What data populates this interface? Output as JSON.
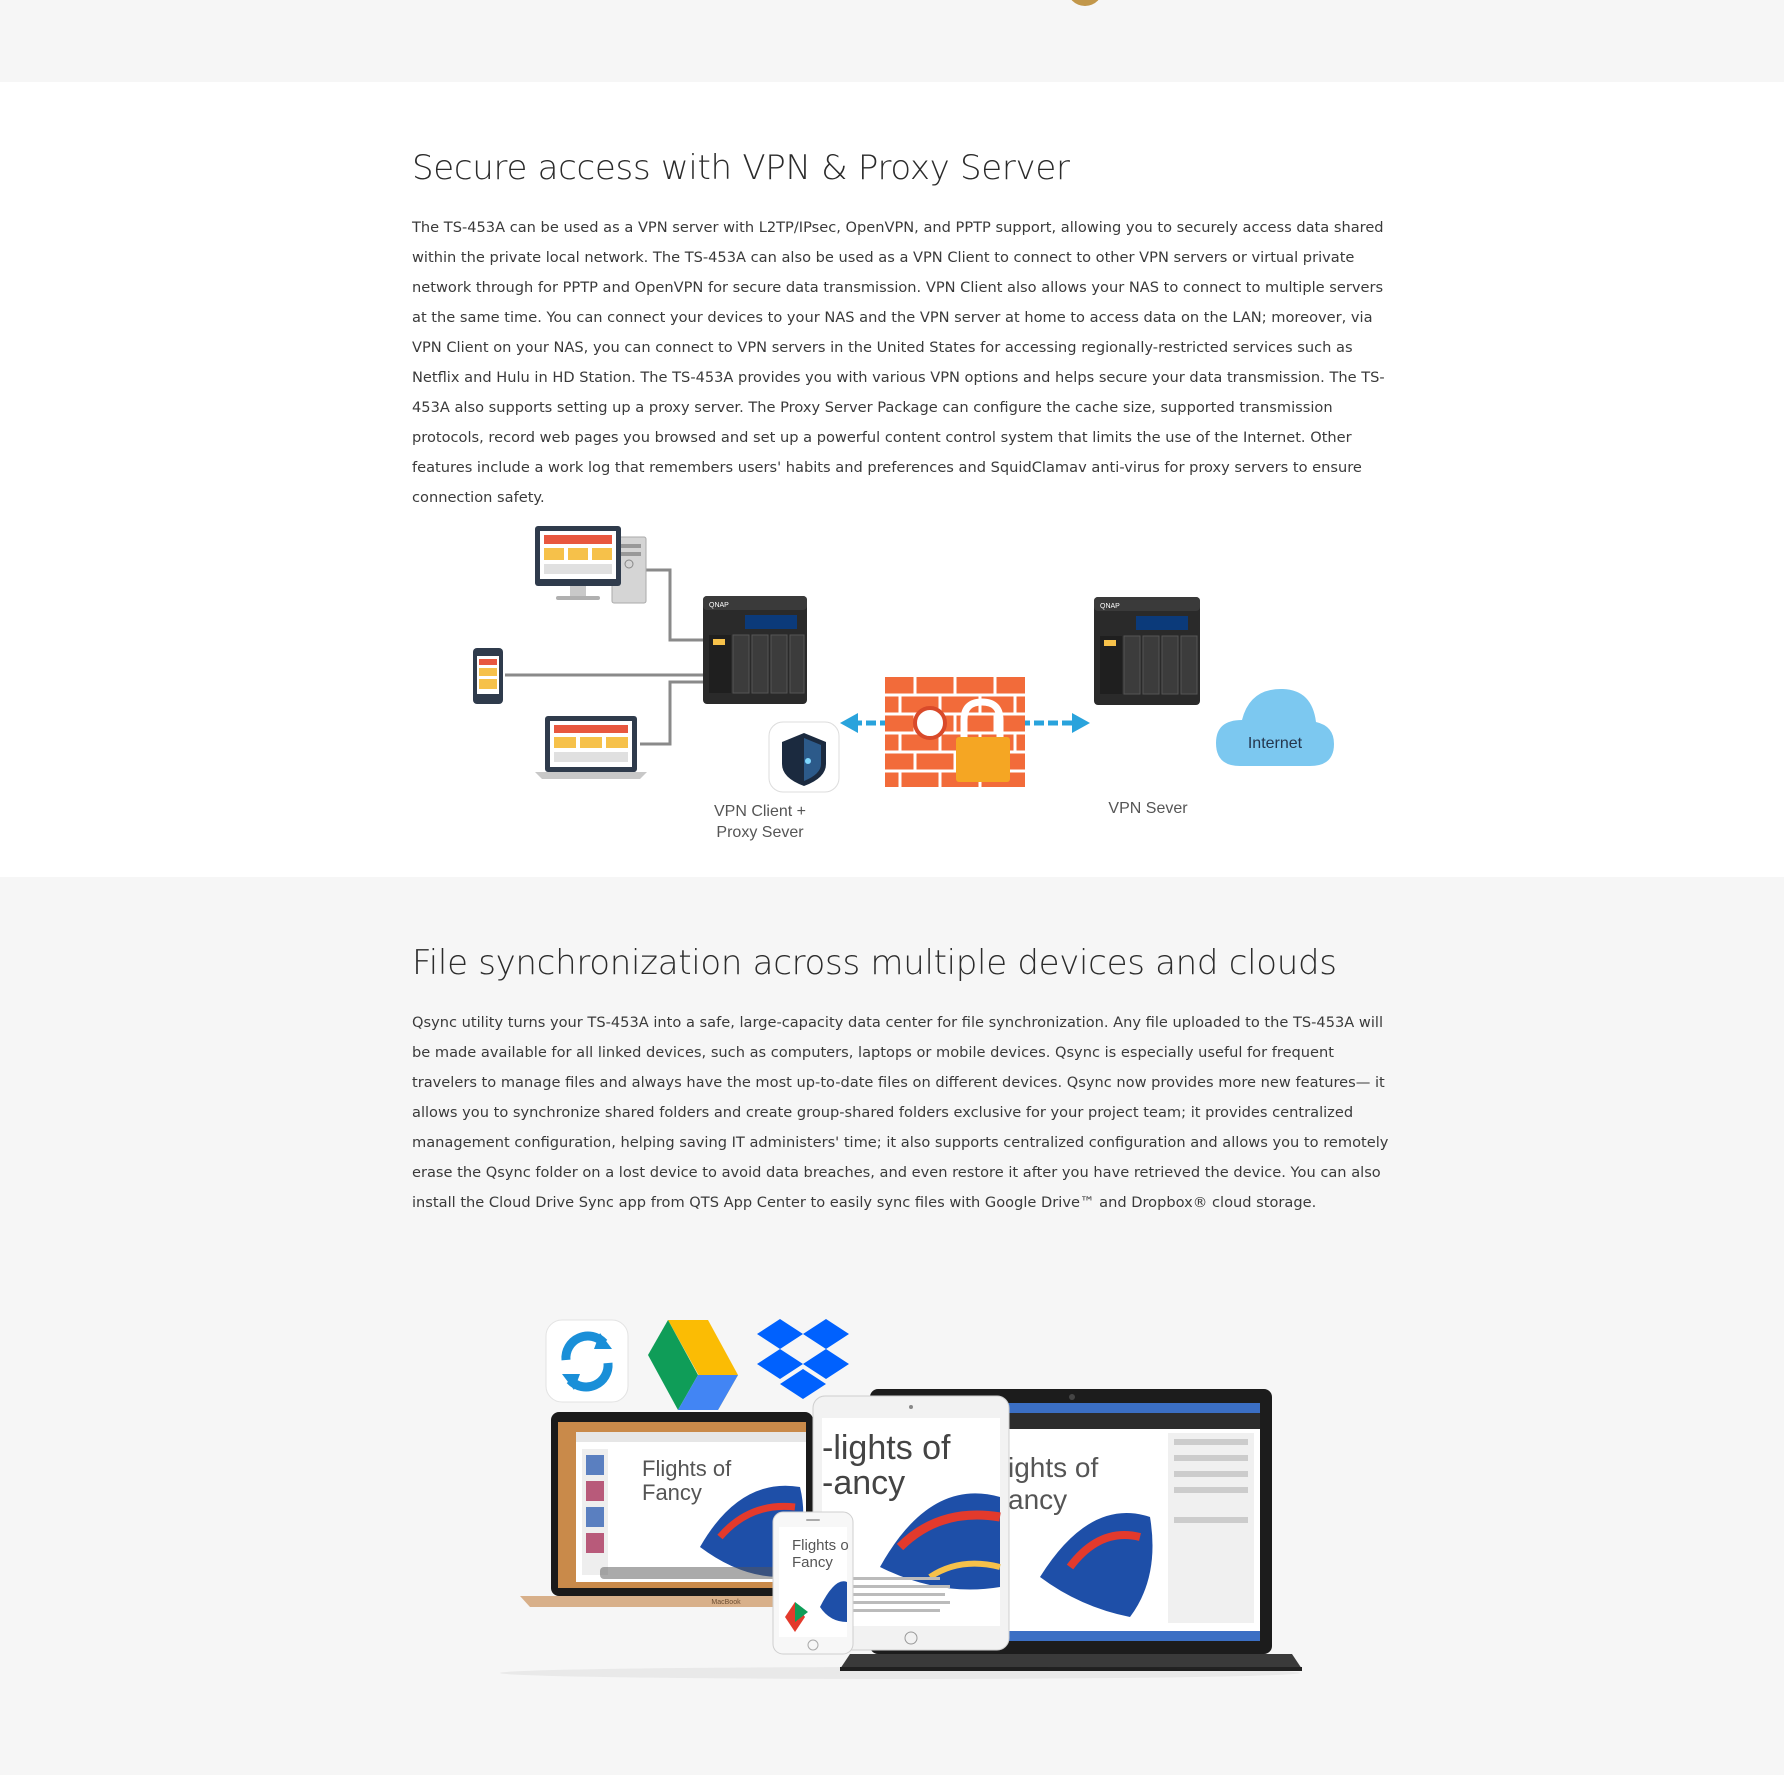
{
  "vpn": {
    "title": "Secure access with VPN & Proxy Server",
    "body": "The TS-453A can be used as a VPN server with L2TP/IPsec, OpenVPN, and PPTP support, allowing you to securely access data shared within the private local network. The TS-453A can also be used as a VPN Client to connect to other VPN servers or virtual private network through for PPTP and OpenVPN for secure data transmission. VPN Client also allows your NAS to connect to multiple servers at the same time. You can connect your devices to your NAS and the VPN server at home to access data on the LAN; moreover, via VPN Client on your NAS, you can connect to VPN servers in the United States for accessing regionally-restricted services such as Netflix and Hulu in HD Station. The TS-453A provides you with various VPN options and helps secure your data transmission. The TS-453A also supports setting up a proxy server. The Proxy Server Package can configure the cache size, supported transmission protocols, record web pages you browsed and set up a powerful content control system that limits the use of the Internet. Other features include a work log that remembers users' habits and preferences and SquidClamav anti-virus for proxy servers to ensure connection safety.",
    "diagram": {
      "client_label_line1": "VPN Client +",
      "client_label_line2": "Proxy Sever",
      "server_label": "VPN Sever",
      "cloud_label": "Internet"
    }
  },
  "sync": {
    "title": "File synchronization across multiple devices and clouds",
    "body": "Qsync utility turns your TS-453A into a safe, large-capacity data center for file synchronization. Any file uploaded to the TS-453A will be made available for all linked devices, such as computers, laptops or mobile devices. Qsync is especially useful for frequent travelers to manage files and always have the most up-to-date files on different devices. Qsync now provides more new features— it allows you to synchronize shared folders and create group-shared folders exclusive for your project team; it provides centralized management configuration, helping saving IT administers' time; it also supports centralized configuration and allows you to remotely erase the Qsync folder on a lost device to avoid data breaches, and even restore it after you have retrieved the device. You can also install the Cloud Drive Sync app from QTS App Center to easily sync files with Google Drive™ and Dropbox® cloud storage.",
    "illustration": {
      "doc_title_line1": "Flights of",
      "doc_title_line2": "Fancy",
      "laptop_brand": "MacBook",
      "icons": [
        "qsync-icon",
        "google-drive-icon",
        "dropbox-icon"
      ]
    }
  },
  "colors": {
    "brick": "#f26b3a",
    "lock": "#f5a623",
    "arrow": "#29a3dc",
    "cloud": "#7cc8f0",
    "screen_orange": "#e8573f",
    "screen_yellow": "#f6c14a"
  }
}
